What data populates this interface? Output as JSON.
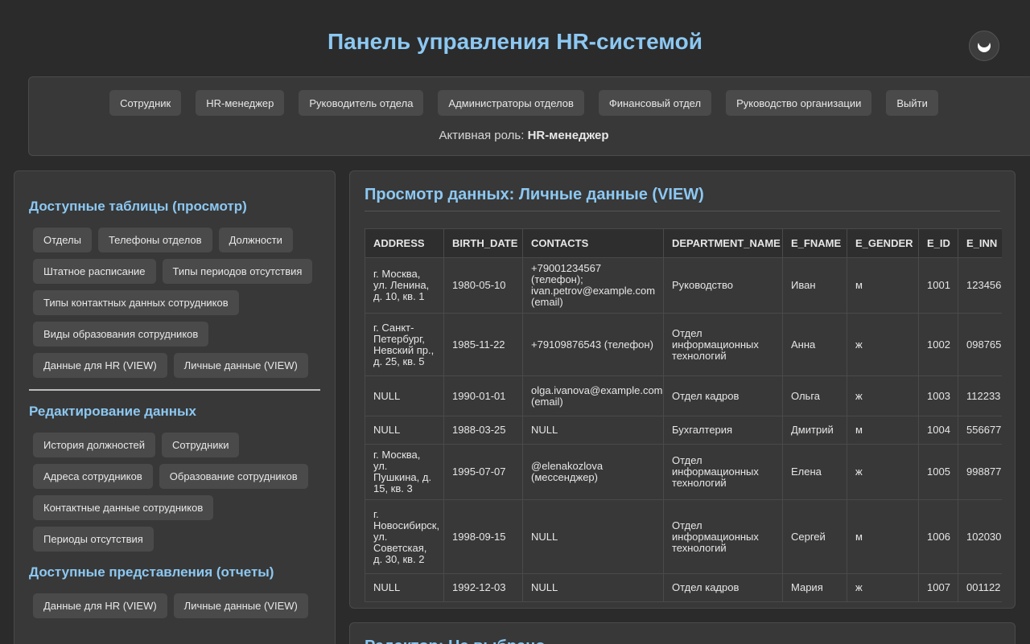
{
  "header": {
    "title": "Панель управления HR-системой",
    "theme_icon": "moon-icon"
  },
  "roles": {
    "buttons": [
      "Сотрудник",
      "HR-менеджер",
      "Руководитель отдела",
      "Администраторы отделов",
      "Финансовый отдел",
      "Руководство организации",
      "Выйти"
    ],
    "active_label": "Активная роль:",
    "active_value": "HR-менеджер"
  },
  "sidebar": {
    "view_title": "Доступные таблицы (просмотр)",
    "view_tables": [
      "Отделы",
      "Телефоны отделов",
      "Должности",
      "Штатное расписание",
      "Типы периодов отсутствия",
      "Типы контактных данных сотрудников",
      "Виды образования сотрудников",
      "Данные для HR (VIEW)",
      "Личные данные (VIEW)"
    ],
    "edit_title": "Редактирование данных",
    "edit_tables": [
      "История должностей",
      "Сотрудники",
      "Адреса сотрудников",
      "Образование сотрудников",
      "Контактные данные сотрудников",
      "Периоды отсутствия"
    ],
    "reports_title": "Доступные представления (отчеты)",
    "reports": [
      "Данные для HR (VIEW)",
      "Личные данные (VIEW)"
    ]
  },
  "main": {
    "title": "Просмотр данных: Личные данные (VIEW)",
    "columns": [
      "ADDRESS",
      "BIRTH_DATE",
      "CONTACTS",
      "DEPARTMENT_NAME",
      "E_FNAME",
      "E_GENDER",
      "E_ID",
      "E_INN"
    ],
    "rows": [
      [
        "г. Москва, ул. Ленина, д. 10, кв. 1",
        "1980-05-10",
        "+79001234567 (телефон); ivan.petrov@example.com (email)",
        "Руководство",
        "Иван",
        "м",
        "1001",
        "123456"
      ],
      [
        "г. Санкт-Петербург, Невский пр., д. 25, кв. 5",
        "1985-11-22",
        "+79109876543 (телефон)",
        "Отдел информационных технологий",
        "Анна",
        "ж",
        "1002",
        "098765"
      ],
      [
        "NULL",
        "1990-01-01",
        "olga.ivanova@example.com (email)",
        "Отдел кадров",
        "Ольга",
        "ж",
        "1003",
        "112233"
      ],
      [
        "NULL",
        "1988-03-25",
        "NULL",
        "Бухгалтерия",
        "Дмитрий",
        "м",
        "1004",
        "556677"
      ],
      [
        "г. Москва, ул. Пушкина, д. 15, кв. 3",
        "1995-07-07",
        "@elenakozlova (мессенджер)",
        "Отдел информационных технологий",
        "Елена",
        "ж",
        "1005",
        "998877"
      ],
      [
        "г. Новосибирск, ул. Советская, д. 30, кв. 2",
        "1998-09-15",
        "NULL",
        "Отдел информационных технологий",
        "Сергей",
        "м",
        "1006",
        "102030"
      ],
      [
        "NULL",
        "1992-12-03",
        "NULL",
        "Отдел кадров",
        "Мария",
        "ж",
        "1007",
        "001122"
      ]
    ]
  },
  "bottom": {
    "title": "Редактор: Не выбрано"
  }
}
